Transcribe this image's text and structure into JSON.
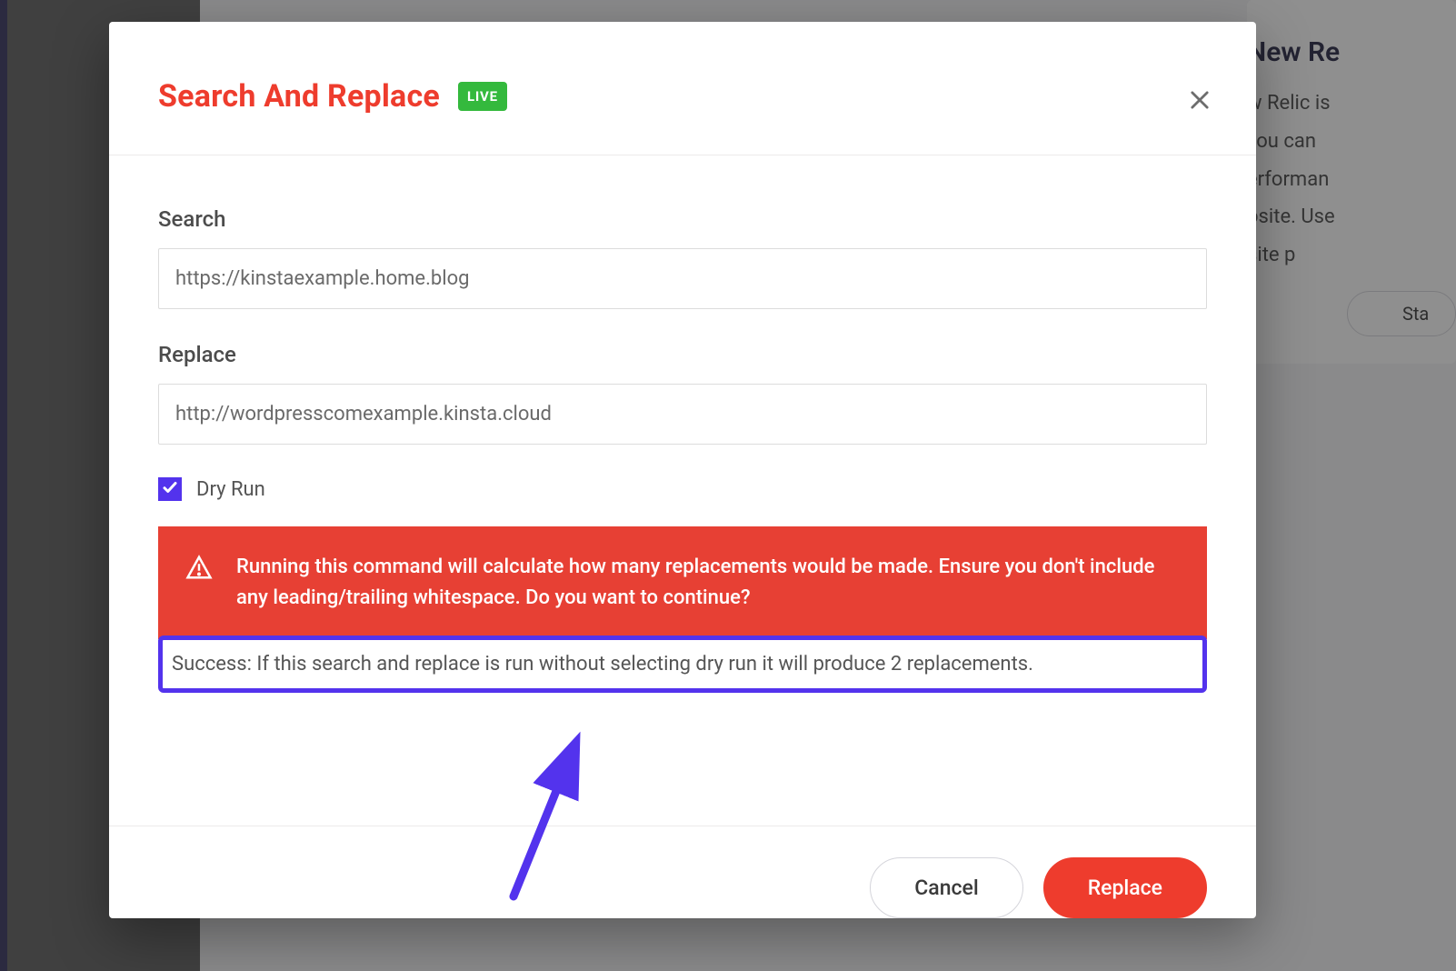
{
  "background": {
    "card_title": "New Re",
    "card_body_lines": [
      "w Relic is",
      "you can",
      "erforman",
      "osite. Use",
      "site p"
    ],
    "button_label": "Sta"
  },
  "modal": {
    "title": "Search And Replace",
    "badge": "LIVE",
    "search": {
      "label": "Search",
      "value": "https://kinstaexample.home.blog"
    },
    "replace": {
      "label": "Replace",
      "value": "http://wordpresscomexample.kinsta.cloud"
    },
    "dry_run": {
      "checked": true,
      "label": "Dry Run"
    },
    "warning": "Running this command will calculate how many replacements would be made. Ensure you don't include any leading/trailing whitespace. Do you want to continue?",
    "success": "Success: If this search and replace is run without selecting dry run it will produce 2 replacements.",
    "cancel_label": "Cancel",
    "replace_label": "Replace"
  }
}
